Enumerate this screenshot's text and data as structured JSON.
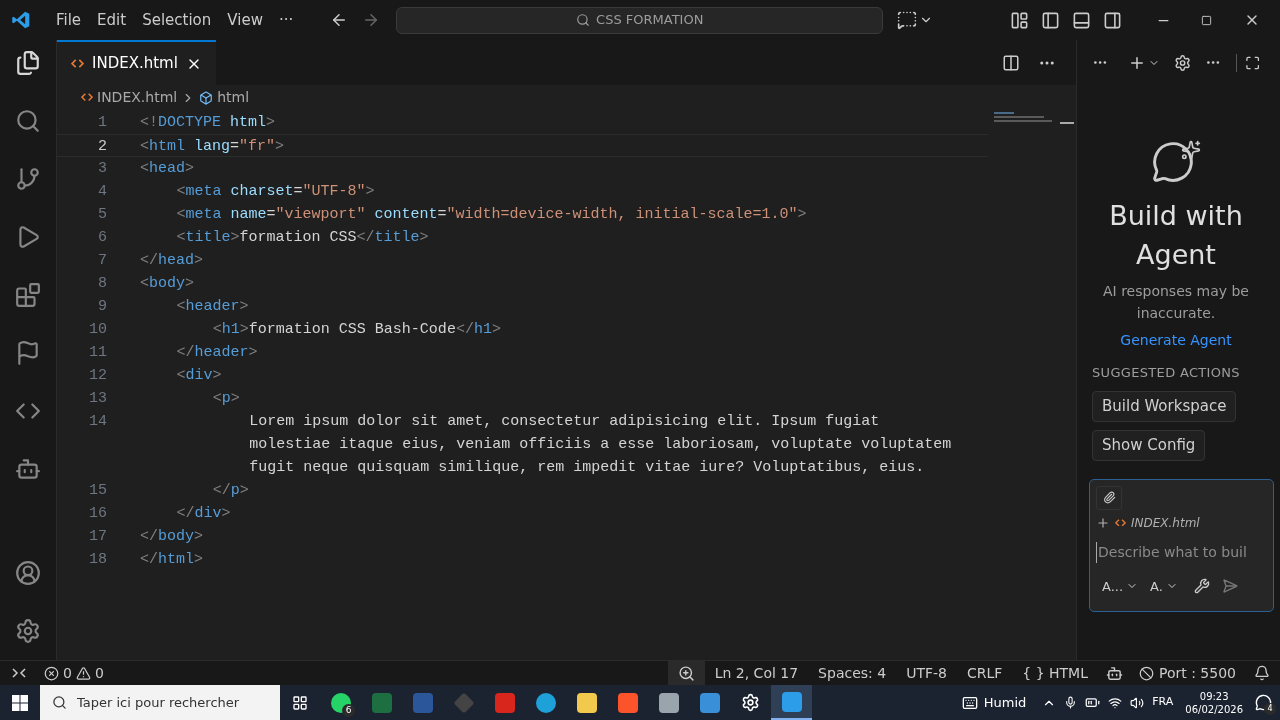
{
  "title_bar": {
    "menus": [
      "File",
      "Edit",
      "Selection",
      "View",
      "···"
    ],
    "search": {
      "value": "CSS FORMATION"
    }
  },
  "tab": {
    "label": "INDEX.html",
    "selected": true
  },
  "breadcrumb": [
    "INDEX.html",
    "html"
  ],
  "code_lines": [
    {
      "number": "1",
      "current": false,
      "tokens": [
        {
          "kind": "punct",
          "text": "<!"
        },
        {
          "kind": "tag",
          "text": "DOCTYPE"
        },
        {
          "kind": "attr",
          "text": " html"
        },
        {
          "kind": "punct",
          "text": ">"
        }
      ]
    },
    {
      "number": "2",
      "current": true,
      "tokens": [
        {
          "kind": "punct",
          "text": "<"
        },
        {
          "kind": "tag",
          "text": "html"
        },
        {
          "kind": "attr",
          "text": " lang"
        },
        {
          "kind": "text",
          "text": "="
        },
        {
          "kind": "string",
          "text": "\"fr\""
        },
        {
          "kind": "punct",
          "text": ">"
        }
      ]
    },
    {
      "number": "3",
      "current": false,
      "tokens": [
        {
          "kind": "punct",
          "text": "<"
        },
        {
          "kind": "tag",
          "text": "head"
        },
        {
          "kind": "punct",
          "text": ">"
        }
      ],
      "children": [
        {
          "number": "4",
          "current": false,
          "tokens": [
            {
              "kind": "punct",
              "text": "<"
            },
            {
              "kind": "tag",
              "text": "meta"
            },
            {
              "kind": "attr",
              "text": " charset"
            },
            {
              "kind": "text",
              "text": "="
            },
            {
              "kind": "string",
              "text": "\"UTF-8\""
            },
            {
              "kind": "punct",
              "text": ">"
            }
          ]
        },
        {
          "number": "5",
          "current": false,
          "tokens": [
            {
              "kind": "punct",
              "text": "<"
            },
            {
              "kind": "tag",
              "text": "meta"
            },
            {
              "kind": "attr",
              "text": " name"
            },
            {
              "kind": "text",
              "text": "="
            },
            {
              "kind": "string",
              "text": "\"viewport\""
            },
            {
              "kind": "attr",
              "text": " content"
            },
            {
              "kind": "text",
              "text": "="
            },
            {
              "kind": "string",
              "text": "\"width=device-width, initial-scale=1.0\""
            },
            {
              "kind": "punct",
              "text": ">"
            }
          ]
        },
        {
          "number": "6",
          "current": false,
          "tokens": [
            {
              "kind": "punct",
              "text": "<"
            },
            {
              "kind": "tag",
              "text": "title"
            },
            {
              "kind": "punct",
              "text": ">"
            },
            {
              "kind": "text",
              "text": "formation CSS"
            },
            {
              "kind": "punct",
              "text": "</"
            },
            {
              "kind": "tag",
              "text": "title"
            },
            {
              "kind": "punct",
              "text": ">"
            }
          ]
        }
      ]
    },
    {
      "number": "7",
      "current": false,
      "tokens": [
        {
          "kind": "punct",
          "text": "</"
        },
        {
          "kind": "tag",
          "text": "head"
        },
        {
          "kind": "punct",
          "text": ">"
        }
      ]
    },
    {
      "number": "8",
      "current": false,
      "tokens": [
        {
          "kind": "punct",
          "text": "<"
        },
        {
          "kind": "tag",
          "text": "body"
        },
        {
          "kind": "punct",
          "text": ">"
        }
      ],
      "children": [
        {
          "number": "9",
          "current": false,
          "tokens": [
            {
              "kind": "punct",
              "text": "<"
            },
            {
              "kind": "tag",
              "text": "header"
            },
            {
              "kind": "punct",
              "text": ">"
            }
          ],
          "children": [
            {
              "number": "10",
              "current": false,
              "tokens": [
                {
                  "kind": "punct",
                  "text": "<"
                },
                {
                  "kind": "tag",
                  "text": "h1"
                },
                {
                  "kind": "punct",
                  "text": ">"
                },
                {
                  "kind": "text",
                  "text": "formation CSS Bash-Code"
                },
                {
                  "kind": "punct",
                  "text": "</"
                },
                {
                  "kind": "tag",
                  "text": "h1"
                },
                {
                  "kind": "punct",
                  "text": ">"
                }
              ]
            }
          ]
        },
        {
          "number": "11",
          "current": false,
          "tokens": [
            {
              "kind": "punct",
              "text": "</"
            },
            {
              "kind": "tag",
              "text": "header"
            },
            {
              "kind": "punct",
              "text": ">"
            }
          ]
        },
        {
          "number": "12",
          "current": false,
          "tokens": [
            {
              "kind": "punct",
              "text": "<"
            },
            {
              "kind": "tag",
              "text": "div"
            },
            {
              "kind": "punct",
              "text": ">"
            }
          ],
          "children": [
            {
              "number": "13",
              "current": false,
              "tokens": [
                {
                  "kind": "punct",
                  "text": "<"
                },
                {
                  "kind": "tag",
                  "text": "p"
                },
                {
                  "kind": "punct",
                  "text": ">"
                }
              ],
              "children": [
                {
                  "number": "14",
                  "current": false,
                  "wrapped": [
                    "Lorem ipsum dolor sit amet, consectetur adipisicing elit. Ipsum fugiat",
                    "molestiae itaque eius, veniam officiis a esse laboriosam, voluptate voluptatem",
                    "fugit neque quisquam similique, rem impedit vitae iure? Voluptatibus, eius."
                  ]
                }
              ]
            },
            {
              "number": "15",
              "current": false,
              "tokens": [
                {
                  "kind": "punct",
                  "text": "</"
                },
                {
                  "kind": "tag",
                  "text": "p"
                },
                {
                  "kind": "punct",
                  "text": ">"
                }
              ]
            }
          ]
        },
        {
          "number": "16",
          "current": false,
          "tokens": [
            {
              "kind": "punct",
              "text": "</"
            },
            {
              "kind": "tag",
              "text": "div"
            },
            {
              "kind": "punct",
              "text": ">"
            }
          ]
        }
      ]
    },
    {
      "number": "17",
      "current": false,
      "tokens": [
        {
          "kind": "punct",
          "text": "</"
        },
        {
          "kind": "tag",
          "text": "body"
        },
        {
          "kind": "punct",
          "text": ">"
        }
      ]
    },
    {
      "number": "18",
      "current": false,
      "tokens": [
        {
          "kind": "punct",
          "text": "</"
        },
        {
          "kind": "tag",
          "text": "html"
        },
        {
          "kind": "punct",
          "text": ">"
        }
      ]
    }
  ],
  "agent_panel": {
    "title": "Build with Agent",
    "subtitle": "AI responses may be inaccurate.",
    "link": "Generate Agent",
    "section": "SUGGESTED ACTIONS",
    "actions": [
      "Build Workspace",
      "Show Config"
    ],
    "chat": {
      "attachment": "INDEX.html",
      "placeholder": "Describe what to buil",
      "mode": "A...",
      "model": "A."
    }
  },
  "status_bar": {
    "errors": "0",
    "warnings": "0",
    "items": [
      "Ln 2, Col 17",
      "Spaces: 4",
      "UTF-8",
      "CRLF",
      "{ } HTML"
    ],
    "port": "Port : 5500"
  },
  "taskbar": {
    "search_placeholder": "Taper ici pour rechercher",
    "whatsapp_badge": "6",
    "weather": "Humid",
    "language": "FRA",
    "time": "09:23",
    "date": "06/02/2026",
    "notifications": "4"
  }
}
